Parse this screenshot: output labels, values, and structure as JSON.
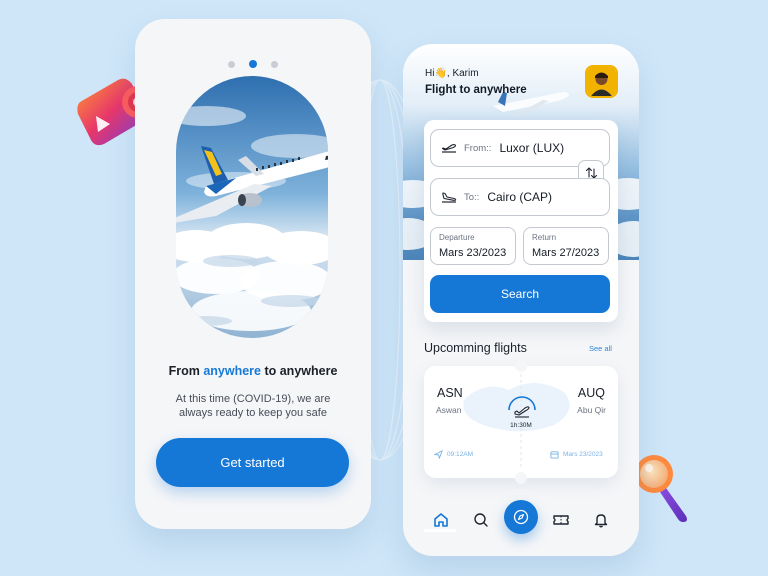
{
  "onboarding": {
    "title_part1": "From ",
    "title_highlight": "anywhere",
    "title_part2": " to anywhere",
    "subtitle": "At this time (COVID-19), we are always ready to keep you safe",
    "cta_label": "Get started",
    "carousel": {
      "total": 3,
      "active_index": 1
    }
  },
  "home": {
    "greeting": "Hi👋, Karim",
    "headline": "Flight to anywhere",
    "form": {
      "from_label": "From::",
      "from_value": "Luxor (LUX)",
      "to_label": "To::",
      "to_value": "Cairo (CAP)",
      "departure_label": "Departure",
      "departure_value": "Mars 23/2023",
      "return_label": "Return",
      "return_value": "Mars 27/2023",
      "search_label": "Search"
    },
    "upcoming": {
      "title": "Upcomming flights",
      "see_all": "See all",
      "flight": {
        "from_code": "ASN",
        "from_city": "Aswan",
        "to_code": "AUQ",
        "to_city": "Abu Qir",
        "duration": "1h:30M",
        "time": "09:12AM",
        "date": "Mars 23/2023"
      }
    },
    "nav": [
      "home-icon",
      "search-icon",
      "compass-icon",
      "ticket-icon",
      "bell-icon"
    ]
  },
  "colors": {
    "accent": "#1577d6",
    "background": "#cfe6f8",
    "card": "#f5f6f8"
  }
}
